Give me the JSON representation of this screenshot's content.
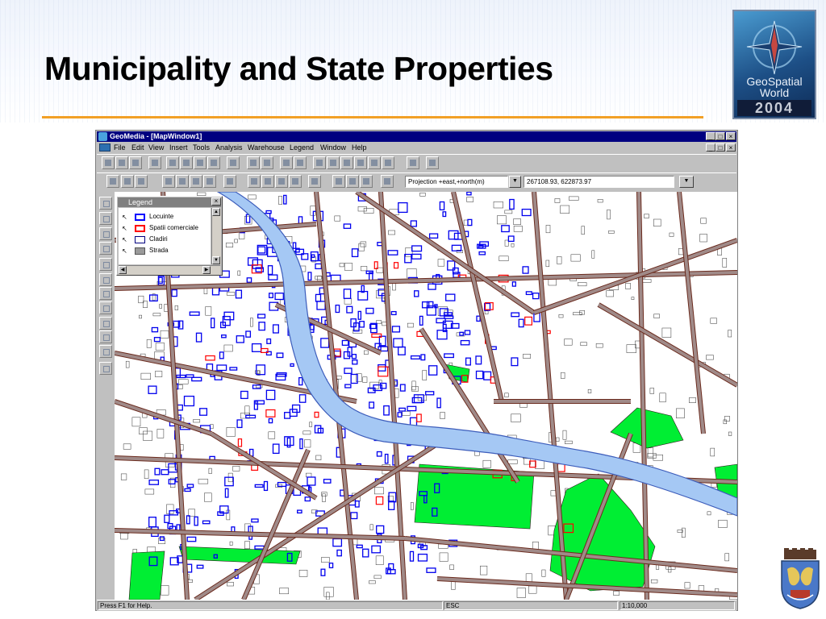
{
  "slide": {
    "title": "Municipality and State Properties",
    "logo_line1": "GeoSpatial",
    "logo_line2": "World",
    "logo_year": "2004"
  },
  "window": {
    "title": "GeoMedia - [MapWindow1]",
    "controls": [
      "_",
      "□",
      "×"
    ],
    "menu": [
      "File",
      "Edit",
      "View",
      "Insert",
      "Tools",
      "Analysis",
      "Warehouse",
      "Legend",
      "Window",
      "Help"
    ]
  },
  "toolbar": {
    "projection_value": "Projection +east,+north(m)",
    "coordinate_value": "267108.93, 622873.97"
  },
  "legend": {
    "title": "Legend",
    "close": "×",
    "items": [
      {
        "label": "Locuinte",
        "style": "outline",
        "color": "#0000ff"
      },
      {
        "label": "Spatii comerciale",
        "style": "outline",
        "color": "#ff0000"
      },
      {
        "label": "Cladiri",
        "style": "outline",
        "color": "#000080"
      },
      {
        "label": "Strada",
        "style": "fill",
        "color": "#9a9a9a"
      }
    ]
  },
  "map": {
    "colors": {
      "river": "#a5c8f4",
      "river_edge": "#3d5dbb",
      "street": "#a08a88",
      "street_edge": "#6b2b1e",
      "park": "#00ee33",
      "residential": "#0000ee",
      "commercial": "#ff0000",
      "building": "#2d3fe0"
    }
  },
  "status": {
    "help": "Press F1 for Help.",
    "key": "ESC",
    "scale": "1:10,000"
  }
}
